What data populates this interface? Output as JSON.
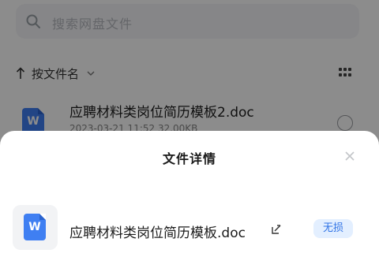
{
  "search": {
    "placeholder": "搜索网盘文件",
    "icon": "search-icon"
  },
  "sort": {
    "label": "按文件名",
    "icon_up": "arrow-up-icon",
    "icon_down": "chevron-down-icon"
  },
  "view_toggle": {
    "icon": "grid-view-icon"
  },
  "file_list": {
    "items": [
      {
        "name": "应聘材料类岗位简历模板2.doc",
        "meta": "2023-03-21 11:52  32.00KB",
        "icon": "word-doc-icon",
        "badge_letter": "W"
      }
    ]
  },
  "sheet": {
    "title": "文件详情",
    "close_icon": "close-icon",
    "file": {
      "name": "应聘材料类岗位简历模板.doc",
      "icon_letter": "W",
      "edit_icon": "edit-icon",
      "badge": "无损"
    }
  },
  "colors": {
    "accent": "#3f7ff2",
    "badge_bg": "#e3efff",
    "badge_text": "#2f73e6"
  }
}
